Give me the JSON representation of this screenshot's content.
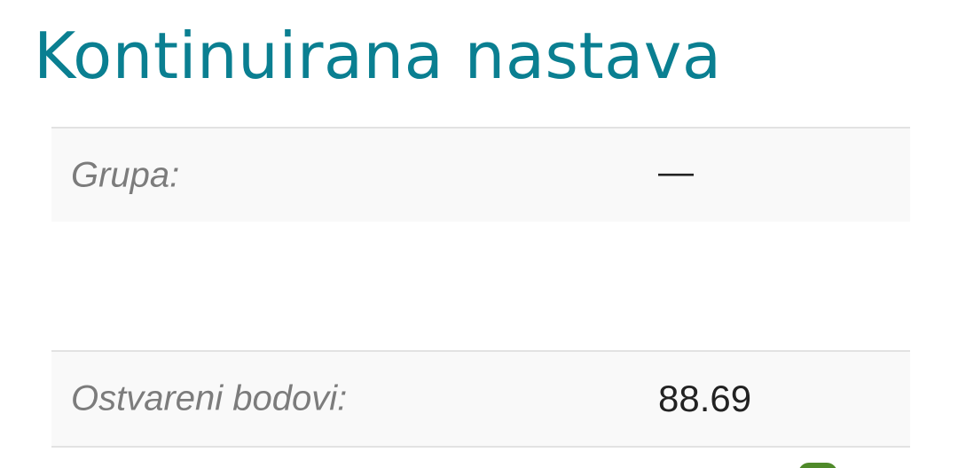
{
  "page": {
    "title": "Kontinuirana nastava"
  },
  "info": {
    "group": {
      "label": "Grupa:",
      "value": "—"
    },
    "points": {
      "label": "Ostvareni bodovi:",
      "value": "88.69"
    }
  },
  "colors": {
    "title": "#0a7f91",
    "row_background": "#f9f9f9",
    "row_border": "#e2e2e2",
    "label_text": "#7c7c7c",
    "value_text": "#222222",
    "partial_badge": "#4f8a2a"
  }
}
